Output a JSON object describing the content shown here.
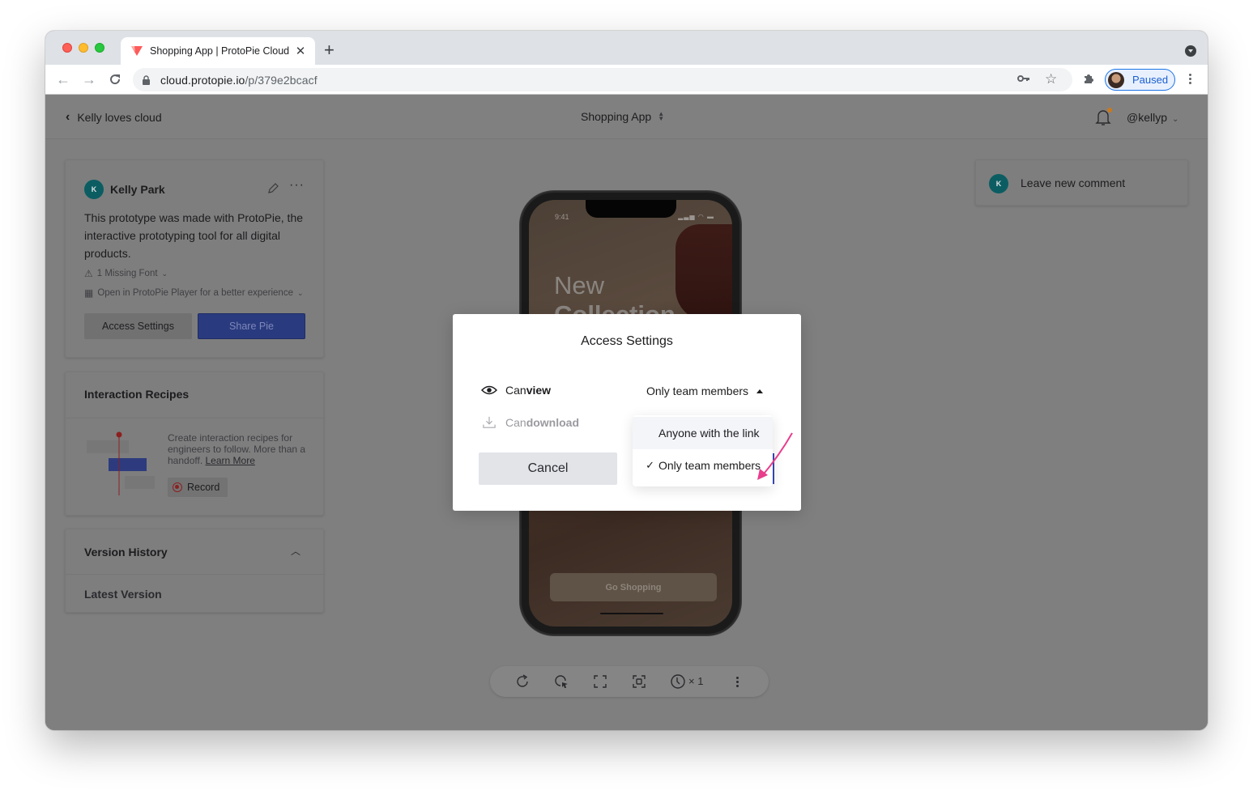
{
  "browser": {
    "tab_title": "Shopping App | ProtoPie Cloud",
    "url_host": "cloud.protopie.io",
    "url_path": "/p/379e2bcacf",
    "profile_label": "Paused",
    "icons": [
      "back-arrow-icon",
      "forward-arrow-icon",
      "reload-icon",
      "lock-icon",
      "key-icon",
      "star-icon",
      "extensions-icon",
      "menu-icon"
    ]
  },
  "header": {
    "back_label": "Kelly loves cloud",
    "project_title": "Shopping App",
    "username": "@kellyp"
  },
  "info_card": {
    "author_initial": "K",
    "author_name": "Kelly Park",
    "description": "This prototype was made with ProtoPie, the interactive prototyping tool for all digital products.",
    "missing_font": "1 Missing Font",
    "player_hint": "Open in ProtoPie Player for a better experience",
    "access_settings_label": "Access Settings",
    "share_label": "Share Pie"
  },
  "recipes": {
    "title": "Interaction Recipes",
    "text": "Create interaction recipes for engineers to follow. More than a handoff.",
    "learn_more": "Learn More",
    "record_label": "Record"
  },
  "versions": {
    "title": "Version History",
    "latest_label": "Latest Version"
  },
  "comment": {
    "initial": "K",
    "label": "Leave new comment"
  },
  "phone": {
    "status_time": "9:41",
    "hero_line1": "New",
    "hero_line2": "Collection",
    "cta": "Go Shopping"
  },
  "controls": {
    "speed": "× 1"
  },
  "modal": {
    "title": "Access Settings",
    "view_prefix": "Can ",
    "view_bold": "view",
    "download_prefix": "Can ",
    "download_bold": "download",
    "selected": "Only team members",
    "cancel_label": "Cancel",
    "options": [
      {
        "label": "Anyone with the link",
        "checked": false
      },
      {
        "label": "Only team members",
        "checked": true
      }
    ]
  },
  "colors": {
    "accent_blue": "#3749b8",
    "teal_avatar": "#0b5d62",
    "annotation_pink": "#e83e8c"
  }
}
